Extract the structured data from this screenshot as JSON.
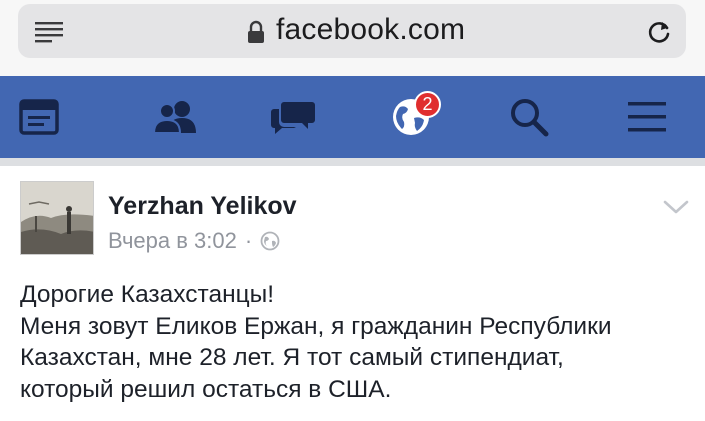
{
  "browser": {
    "url": "facebook.com",
    "icons": {
      "reader": "reader-view-icon",
      "lock": "lock-icon",
      "reload": "reload-icon"
    }
  },
  "nav": {
    "items": [
      {
        "name": "news-feed",
        "icon": "news-feed-icon"
      },
      {
        "name": "friend-requests",
        "icon": "friends-icon"
      },
      {
        "name": "messages",
        "icon": "messages-icon"
      },
      {
        "name": "notifications",
        "icon": "globe-icon"
      },
      {
        "name": "search",
        "icon": "search-icon"
      },
      {
        "name": "menu",
        "icon": "hamburger-menu-icon"
      }
    ],
    "notification_count": "2",
    "colors": {
      "bar": "#4267b2",
      "badge": "#e02e2e"
    }
  },
  "post": {
    "author": "Yerzhan Yelikov",
    "timestamp": "Вчера в 3:02",
    "separator": "·",
    "privacy_icon": "public-globe-icon",
    "options_icon": "chevron-down-icon",
    "text_lines": [
      "Дорогие Казахстанцы!",
      "Меня зовут Еликов Ержан, я гражданин Республики",
      "Казахстан, мне 28 лет. Я тот самый стипендиат,",
      "который решил остаться в США."
    ]
  }
}
